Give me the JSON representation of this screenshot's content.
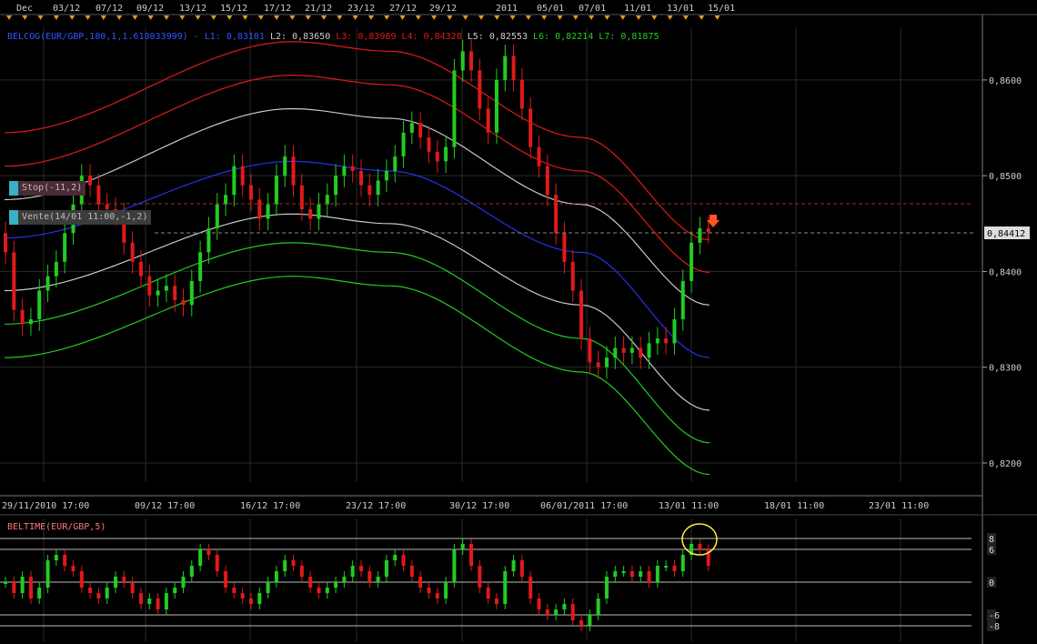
{
  "timeline_labels": [
    "Dec",
    "03/12",
    "07/12",
    "09/12",
    "13/12",
    "15/12",
    "17/12",
    "21/12",
    "23/12",
    "27/12",
    "29/12",
    "2011",
    "05/01",
    "07/01",
    "11/01",
    "13/01",
    "15/01"
  ],
  "bottom_time_labels": [
    "29/11/2010 17:00",
    "09/12 17:00",
    "16/12 17:00",
    "23/12 17:00",
    "30/12 17:00",
    "06/01/2011 17:00",
    "13/01 11:00",
    "18/01 11:00",
    "23/01 11:00"
  ],
  "indicator": {
    "name": "BELCOG(EUR/GBP,180,1,1.618033999)",
    "lines": [
      {
        "key": "L1",
        "value": "0,83101",
        "color": "#3355ff"
      },
      {
        "key": "L2",
        "value": "0,83650",
        "color": "#cccccc"
      },
      {
        "key": "L3",
        "value": "0,83989",
        "color": "#e01a1a"
      },
      {
        "key": "L4",
        "value": "0,84328",
        "color": "#e01a1a"
      },
      {
        "key": "L5",
        "value": "0,82553",
        "color": "#cccccc"
      },
      {
        "key": "L6",
        "value": "0,82214",
        "color": "#22cc22"
      },
      {
        "key": "L7",
        "value": "0,81875",
        "color": "#22cc22"
      }
    ]
  },
  "price_axis": {
    "labels": [
      "0,8600",
      "0,8500",
      "0,8400",
      "0,8300",
      "0,8200"
    ],
    "current_price": "0,84412"
  },
  "orders": {
    "stop_label": "Stop(-11,2)",
    "sell_label": "Vente(14/01 11:00,-1,2)"
  },
  "subchart": {
    "title": "BELTIME(EUR/GBP,5)",
    "axis_labels": [
      "8",
      "6",
      "0",
      "-6",
      "-8"
    ]
  },
  "colors": {
    "up_candle": "#22cc22",
    "down_candle": "#e01a1a",
    "grid": "#2a2a2a",
    "axis_text": "#cccccc",
    "blue_line": "#2233ee",
    "white_line": "#c8c8c8",
    "red_line": "#e01a1a",
    "green_line": "#22cc22",
    "marker": "#d4a017",
    "highlight_circle": "#ffee33"
  },
  "chart_data": {
    "type": "line",
    "x_range": [
      "29/11/2010",
      "23/01/2011"
    ],
    "ylim": [
      0.818,
      0.8655
    ],
    "series": [
      {
        "name": "L1",
        "key_points": [
          [
            0,
            0.8435
          ],
          [
            45,
            0.8515
          ],
          [
            60,
            0.8505
          ],
          [
            90,
            0.842
          ],
          [
            110,
            0.831
          ]
        ]
      },
      {
        "name": "L2",
        "key_points": [
          [
            0,
            0.8475
          ],
          [
            45,
            0.857
          ],
          [
            60,
            0.856
          ],
          [
            90,
            0.847
          ],
          [
            110,
            0.8365
          ]
        ]
      },
      {
        "name": "L3",
        "key_points": [
          [
            0,
            0.851
          ],
          [
            45,
            0.8605
          ],
          [
            60,
            0.8595
          ],
          [
            90,
            0.8505
          ],
          [
            110,
            0.8399
          ]
        ]
      },
      {
        "name": "L4",
        "key_points": [
          [
            0,
            0.8545
          ],
          [
            45,
            0.864
          ],
          [
            60,
            0.863
          ],
          [
            90,
            0.854
          ],
          [
            110,
            0.8433
          ]
        ]
      },
      {
        "name": "L5",
        "key_points": [
          [
            0,
            0.838
          ],
          [
            45,
            0.846
          ],
          [
            60,
            0.845
          ],
          [
            90,
            0.8365
          ],
          [
            110,
            0.8255
          ]
        ]
      },
      {
        "name": "L6",
        "key_points": [
          [
            0,
            0.8345
          ],
          [
            45,
            0.843
          ],
          [
            60,
            0.842
          ],
          [
            90,
            0.833
          ],
          [
            110,
            0.8221
          ]
        ]
      },
      {
        "name": "L7",
        "key_points": [
          [
            0,
            0.831
          ],
          [
            45,
            0.8395
          ],
          [
            60,
            0.8385
          ],
          [
            90,
            0.8295
          ],
          [
            110,
            0.8188
          ]
        ]
      }
    ],
    "candles_close": [
      0.842,
      0.836,
      0.8345,
      0.835,
      0.838,
      0.8395,
      0.841,
      0.844,
      0.847,
      0.85,
      0.849,
      0.847,
      0.8465,
      0.846,
      0.843,
      0.841,
      0.8395,
      0.8375,
      0.838,
      0.8385,
      0.837,
      0.8365,
      0.839,
      0.842,
      0.8445,
      0.847,
      0.848,
      0.851,
      0.849,
      0.8475,
      0.8455,
      0.847,
      0.85,
      0.852,
      0.849,
      0.8465,
      0.8455,
      0.847,
      0.848,
      0.85,
      0.851,
      0.8505,
      0.849,
      0.848,
      0.8495,
      0.8505,
      0.852,
      0.8545,
      0.8555,
      0.854,
      0.8525,
      0.8515,
      0.853,
      0.861,
      0.863,
      0.861,
      0.857,
      0.8545,
      0.86,
      0.8625,
      0.86,
      0.857,
      0.853,
      0.851,
      0.848,
      0.844,
      0.841,
      0.838,
      0.833,
      0.8305,
      0.83,
      0.831,
      0.832,
      0.8315,
      0.832,
      0.831,
      0.8325,
      0.833,
      0.8325,
      0.835,
      0.839,
      0.843,
      0.8445,
      0.8441
    ],
    "subchart_values": [
      0,
      -2,
      1,
      -3,
      -1,
      4,
      5,
      3,
      2,
      -1,
      -2,
      -3,
      -1,
      1,
      0,
      -2,
      -4,
      -3,
      -5,
      -2,
      -1,
      1,
      3,
      6,
      5,
      2,
      -1,
      -2,
      -3,
      -4,
      -2,
      0,
      2,
      4,
      3,
      1,
      -1,
      -2,
      -1,
      0,
      1,
      3,
      2,
      0,
      1,
      4,
      5,
      3,
      1,
      -1,
      -2,
      -3,
      0,
      6,
      7,
      3,
      -1,
      -3,
      -4,
      2,
      4,
      1,
      -3,
      -5,
      -6,
      -5,
      -4,
      -7,
      -8,
      -6,
      -3,
      1,
      2,
      2,
      1,
      2,
      0,
      3,
      3,
      2,
      5,
      7,
      6,
      3
    ]
  }
}
